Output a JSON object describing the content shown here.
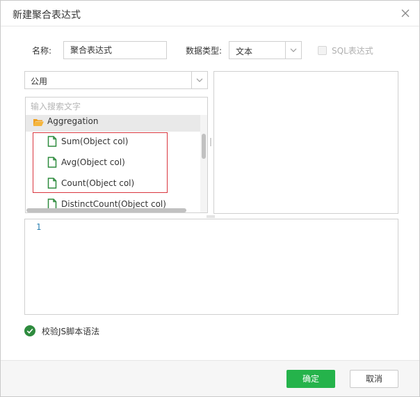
{
  "dialog": {
    "title": "新建聚合表达式",
    "close_icon": "close-icon"
  },
  "form": {
    "name_label": "名称:",
    "name_value": "聚合表达式",
    "datatype_label": "数据类型:",
    "datatype_value": "文本",
    "sql_label": "SQL表达式",
    "sql_checked": false
  },
  "category": {
    "selected": "公用"
  },
  "search": {
    "placeholder": "输入搜索文字"
  },
  "tree": {
    "folder": {
      "label": "Aggregation",
      "icon": "folder-open-icon",
      "color": "#f5a623"
    },
    "items": [
      {
        "label": "Sum(Object col)",
        "icon": "file-icon"
      },
      {
        "label": "Avg(Object col)",
        "icon": "file-icon"
      },
      {
        "label": "Count(Object col)",
        "icon": "file-icon"
      },
      {
        "label": "DistinctCount(Object col)",
        "icon": "file-icon"
      }
    ],
    "file_icon_color": "#2e8b3e",
    "highlight_color": "#d9363e"
  },
  "editor": {
    "line_numbers": [
      "1"
    ]
  },
  "validate": {
    "label": "校验JS脚本语法",
    "icon": "check-circle-icon",
    "color": "#2e8b3e"
  },
  "footer": {
    "confirm_label": "确定",
    "cancel_label": "取消",
    "accent_color": "#25b34b"
  }
}
